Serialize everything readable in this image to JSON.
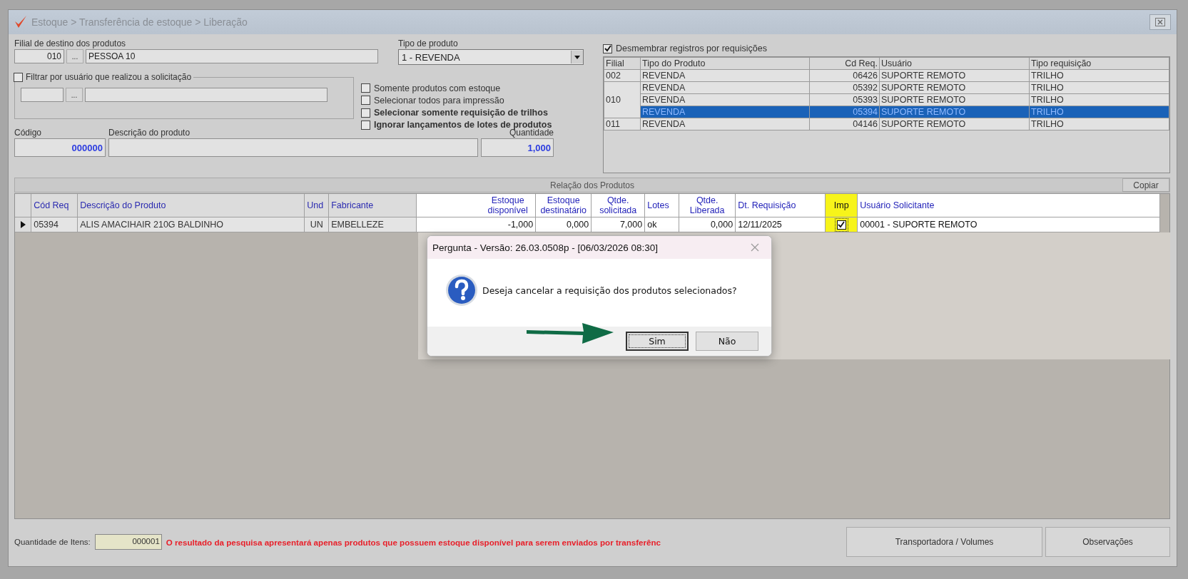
{
  "window": {
    "title": "Estoque > Transferência de estoque > Liberação"
  },
  "destination": {
    "label": "Filial de destino dos produtos",
    "code": "010",
    "browse": "...",
    "name": "PESSOA 10"
  },
  "product_type": {
    "label": "Tipo de produto",
    "value": "1 - REVENDA"
  },
  "user_filter": {
    "label": "Filtrar por usuário que realizou a solicitação",
    "checked": false,
    "browse": "..."
  },
  "options": [
    {
      "label": "Somente produtos com estoque",
      "checked": false,
      "bold": false
    },
    {
      "label": "Selecionar todos para impressão",
      "checked": false,
      "bold": false
    },
    {
      "label": "Selecionar somente requisição de trilhos",
      "checked": false,
      "bold": true
    },
    {
      "label": "Ignorar lançamentos de lotes de produtos",
      "checked": false,
      "bold": true
    }
  ],
  "product": {
    "code_label": "Código",
    "code": "000000",
    "description_label": "Descrição do produto",
    "quantity_label": "Quantidade",
    "quantity": "1,000"
  },
  "split": {
    "label": "Desmembrar registros por requisições",
    "checked": true
  },
  "requests": {
    "columns": [
      "Filial",
      "Tipo do Produto",
      "Cd Req.",
      "Usuário",
      "Tipo requisição"
    ],
    "groups": [
      {
        "filial": "002",
        "rows": [
          {
            "type": "REVENDA",
            "req": "06426",
            "user": "SUPORTE REMOTO",
            "kind": "TRILHO",
            "selected": false
          }
        ]
      },
      {
        "filial": "010",
        "rows": [
          {
            "type": "REVENDA",
            "req": "05392",
            "user": "SUPORTE REMOTO",
            "kind": "TRILHO",
            "selected": false
          },
          {
            "type": "REVENDA",
            "req": "05393",
            "user": "SUPORTE REMOTO",
            "kind": "TRILHO",
            "selected": false
          },
          {
            "type": "REVENDA",
            "req": "05394",
            "user": "SUPORTE REMOTO",
            "kind": "TRILHO",
            "selected": true
          }
        ]
      },
      {
        "filial": "011",
        "rows": [
          {
            "type": "REVENDA",
            "req": "04146",
            "user": "SUPORTE REMOTO",
            "kind": "TRILHO",
            "selected": false
          }
        ]
      }
    ]
  },
  "products": {
    "title": "Relação dos Produtos",
    "copy_button": "Copiar",
    "columns": [
      {
        "label": "Cód Req",
        "highlighted": false
      },
      {
        "label": "Descrição do Produto",
        "highlighted": false
      },
      {
        "label": "Und",
        "highlighted": false
      },
      {
        "label": "Fabricante",
        "highlighted": false
      },
      {
        "label": "Estoque disponível",
        "highlighted": false
      },
      {
        "label": "Estoque destinatário",
        "highlighted": false
      },
      {
        "label": "Qtde. solicitada",
        "highlighted": false
      },
      {
        "label": "Lotes",
        "highlighted": false
      },
      {
        "label": "Qtde. Liberada",
        "highlighted": false
      },
      {
        "label": "Dt. Requisição",
        "highlighted": false
      },
      {
        "label": "Imp",
        "highlighted": true
      },
      {
        "label": "Usuário Solicitante",
        "highlighted": false
      }
    ],
    "rows": [
      {
        "current": true,
        "req": "05394",
        "description": "ALIS AMACIHAIR 210G BALDINHO",
        "unit": "UN",
        "maker": "EMBELLEZE",
        "available": "-1,000",
        "destination": "0,000",
        "requested": "7,000",
        "lots": "ok",
        "released": "0,000",
        "date": "12/11/2025",
        "print": true,
        "user": "00001 - SUPORTE REMOTO"
      }
    ]
  },
  "footer": {
    "count_label": "Quantidade de Itens:",
    "count": "000001",
    "warning": "O resultado da pesquisa apresentará apenas produtos que possuem estoque disponível para serem enviados por transferênc",
    "buttons": [
      "Transportadora / Volumes",
      "Observações"
    ]
  },
  "dialog": {
    "title": "Pergunta - Versão: 26.03.0508p - [06/03/2026 08:30]",
    "message": "Deseja cancelar a requisição dos produtos selecionados?",
    "buttons": [
      {
        "label": "Sim",
        "focused": true
      },
      {
        "label": "Não",
        "focused": false
      }
    ]
  }
}
